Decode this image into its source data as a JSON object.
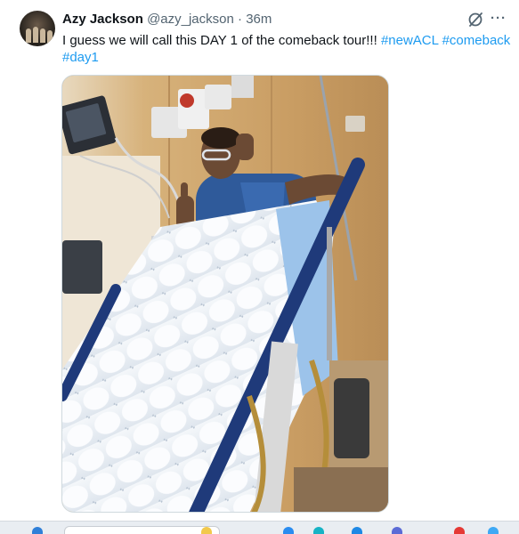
{
  "tweet": {
    "display_name": "Azy Jackson",
    "handle": "@azy_jackson",
    "separator": "·",
    "time_ago": "36m",
    "text_plain": "I guess we will call this DAY 1 of the comeback tour!!! ",
    "hashtags": [
      "#newACL",
      "#comeback",
      "#day1"
    ],
    "more_label": "···",
    "grok_icon": "grok-icon",
    "photo_alt": "Person in hospital bed giving two thumbs up, legs covered by an inflated white blanket"
  },
  "colors": {
    "hashtag": "#1d9bf0",
    "meta": "#536471",
    "text": "#0f1419"
  }
}
